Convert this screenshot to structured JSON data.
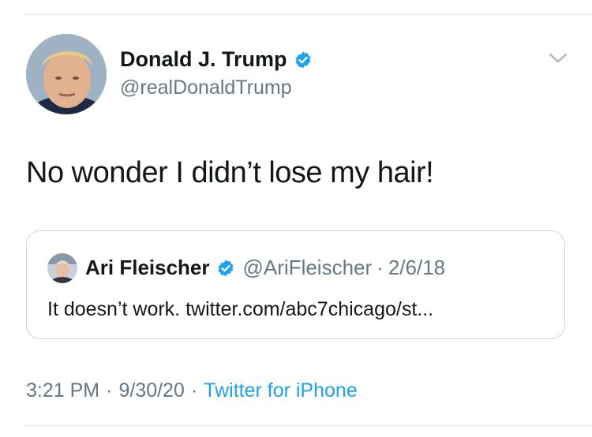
{
  "colors": {
    "text": "#14171a",
    "secondary": "#657786",
    "link": "#1da1f2",
    "verified": "#1da1f2",
    "border": "#ccd6dd"
  },
  "tweet": {
    "author": {
      "name": "Donald J. Trump",
      "handle": "@realDonaldTrump",
      "verified_icon": "verified-badge-icon"
    },
    "text": "No wonder I didn’t lose my hair!",
    "menu_icon": "chevron-down-icon"
  },
  "quoted_tweet": {
    "author": {
      "name": "Ari Fleischer",
      "handle": "@AriFleischer",
      "verified_icon": "verified-badge-icon"
    },
    "separator": "·",
    "date": "2/6/18",
    "text": "It doesn’t work. twitter.com/abc7chicago/st..."
  },
  "meta": {
    "time": "3:21 PM",
    "separator": "·",
    "date": "9/30/20",
    "source": "Twitter for iPhone"
  }
}
